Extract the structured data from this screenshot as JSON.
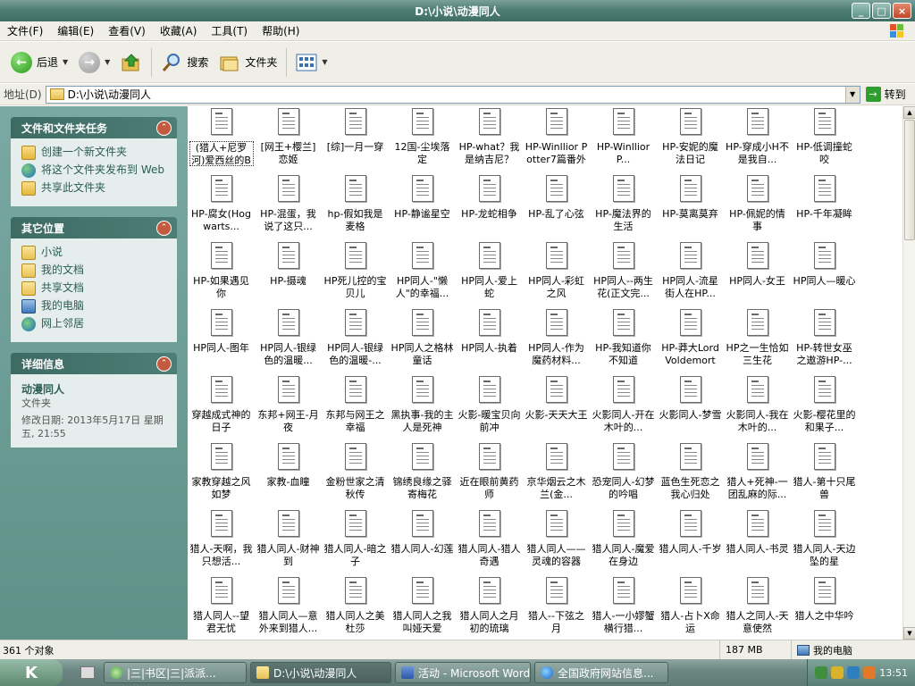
{
  "window": {
    "title": "D:\\小说\\动漫同人"
  },
  "menu": [
    "文件(F)",
    "编辑(E)",
    "查看(V)",
    "收藏(A)",
    "工具(T)",
    "帮助(H)"
  ],
  "toolbar": {
    "back_label": "后退",
    "search_label": "搜索",
    "folders_label": "文件夹"
  },
  "address": {
    "label": "地址(D)",
    "path": "D:\\小说\\动漫同人",
    "go_label": "转到"
  },
  "left_pane": {
    "tasks": {
      "title": "文件和文件夹任务",
      "items": [
        "创建一个新文件夹",
        "将这个文件夹发布到 Web",
        "共享此文件夹"
      ]
    },
    "places": {
      "title": "其它位置",
      "items": [
        "小说",
        "我的文档",
        "共享文档",
        "我的电脑",
        "网上邻居"
      ]
    },
    "details": {
      "title": "详细信息",
      "name": "动漫同人",
      "type": "文件夹",
      "modified": "修改日期: 2013年5月17日 星期五, 21:55"
    }
  },
  "files": [
    "(猎人+尼罗河)爱西丝的BH精彩生活",
    "[网王+樱兰]恋姬",
    "[综]一月一穿",
    "12国-尘埃落定",
    "HP-what？我是纳吉尼？",
    "HP-Winllior Potter7篇番外",
    "HP-WinlliorP...",
    "HP-安妮的魔法日记",
    "HP-穿成小H不是我自...",
    "HP-低调撞蛇咬",
    "HP-腐女(Hogwarts...",
    "HP-混蛋，我说了这只...",
    "hp-假如我是麦格",
    "HP-静谧星空",
    "HP-龙蛇相争",
    "HP-乱了心弦",
    "HP-魔法界的生活",
    "HP-莫离莫弃",
    "HP-佩妮的情事",
    "HP-千年凝眸",
    "HP-如果遇见你",
    "HP-摄魂",
    "HP死儿控的宝贝儿",
    "HP同人-\"懒人\"的幸福...",
    "HP同人-爱上蛇",
    "HP同人-彩虹之风",
    "HP同人--两生花(正文完...",
    "HP同人-流星街人在HP...",
    "HP同人-女王",
    "HP同人—暖心",
    "HP同人-图年",
    "HP同人-银绿色的温暖...",
    "HP同人-银绿色的温暖-...",
    "HP同人之格林童话",
    "HP同人-执着",
    "HP同人-作为魔药材料...",
    "HP-我知道你不知道",
    "HP-莽大LordVoldemort",
    "HP之一生恰如三生花",
    "HP-转世女巫之遨游HP-...",
    "穿越成式神的日子",
    "东邦+网王-月夜",
    "东邦与网王之幸福",
    "黑执事-我的主人是死神",
    "火影-暖宝贝向前冲",
    "火影-天天大王",
    "火影同人-开在木叶的...",
    "火影同人-梦雪",
    "火影同人-我在木叶的...",
    "火影-樱花里的和果子...",
    "家教穿越之风如梦",
    "家教-血瞳",
    "金粉世家之清秋传",
    "锦绣良缘之驿寄梅花",
    "近在眼前黄药师",
    "京华烟云之木兰(金...",
    "恐宠同人-幻梦的吟唱",
    "蓝色生死恋之我心归处",
    "猎人+死神-一团乱麻的际...",
    "猎人-第十只尾兽",
    "猎人-天啊，我只想活...",
    "猎人同人-财神到",
    "猎人同人-暗之子",
    "猎人同人-幻莲",
    "猎人同人-猎人奇遇",
    "猎人同人——灵魂的容器",
    "猎人同人-魔爱在身边",
    "猎人同人-千岁",
    "猎人同人-书灵",
    "猎人同人-天边坠的星",
    "猎人同人--望君无忧",
    "猎人同人—意外来到猎人...",
    "猎人同人之美杜莎",
    "猎人同人之我叫娅天爱",
    "猎人同人之月初的琉璃",
    "猎人--下弦之月",
    "猎人-一小嫪蟹横行猎...",
    "猎人-占卜X命运",
    "猎人之同人-天意使然",
    "猎人之中华吟"
  ],
  "status": {
    "count": "361 个对象",
    "size": "187 MB",
    "location": "我的电脑"
  },
  "taskbar": {
    "tasks": [
      "|三|书区|三|派派...",
      "D:\\小说\\动漫同人",
      "活动 - Microsoft Word",
      "全国政府网站信息..."
    ],
    "clock": "13:51"
  }
}
